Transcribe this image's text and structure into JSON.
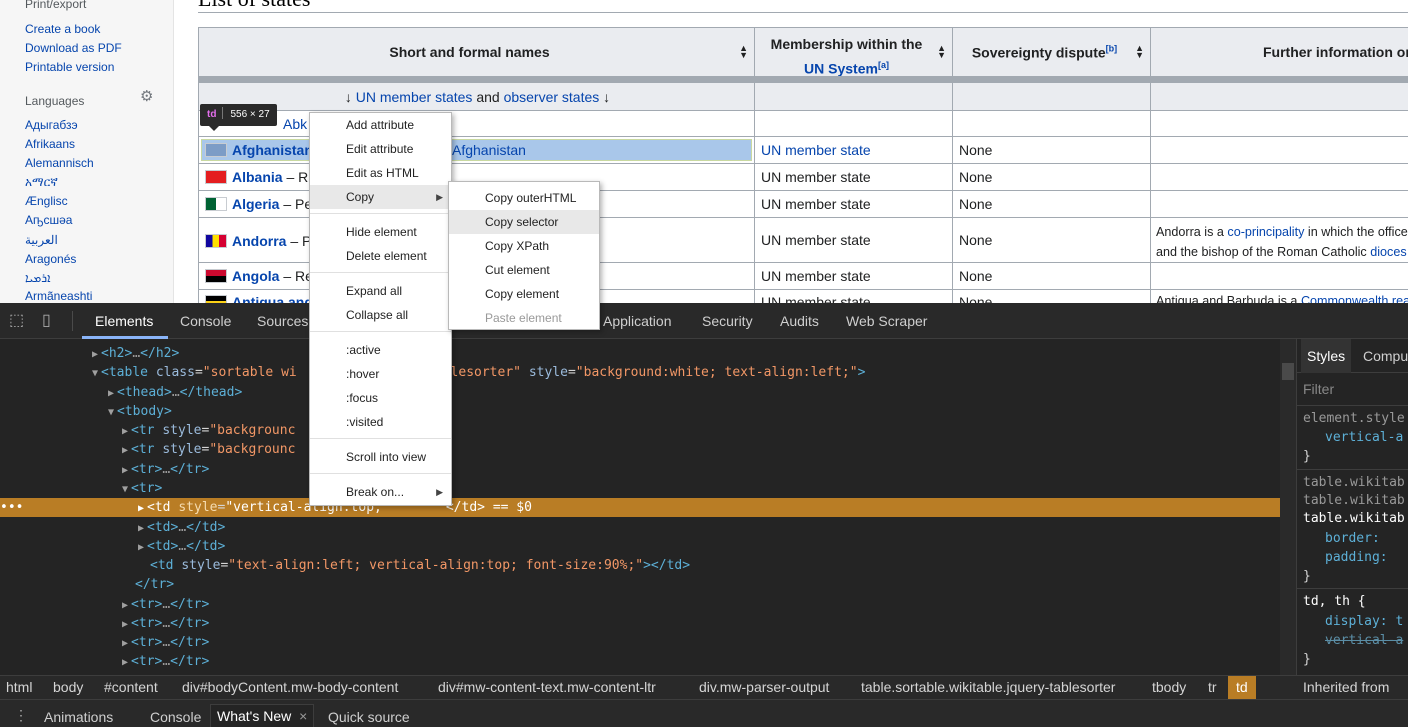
{
  "sidebar": {
    "print_export": "Print/export",
    "tools": [
      "Create a book",
      "Download as PDF",
      "Printable version"
    ],
    "languages_heading": "Languages",
    "languages": [
      "Адыгабзэ",
      "Afrikaans",
      "Alemannisch",
      "አማርኛ",
      "Ænglisc",
      "Аҧсшәа",
      "العربية",
      "Aragonés",
      "ܐܪܡܝܐ",
      "Armãneashti"
    ]
  },
  "page": {
    "heading": "List of states"
  },
  "table": {
    "headers": {
      "names": "Short and formal names",
      "membership": "Membership within the",
      "membership_link": "UN System",
      "membership_sup": "[a]",
      "dispute": "Sovereignty dispute",
      "dispute_sup": "[b]",
      "further": "Further information on"
    },
    "group_row": {
      "arrow": "↓",
      "link1": "UN member states",
      "and": "and",
      "link2": "observer states",
      "arrow2": "↓"
    },
    "rows": [
      {
        "name": "",
        "suffix": "Abk",
        "membership": "",
        "dispute": "",
        "info": ""
      },
      {
        "name": "Afghanistan",
        "suffix": "Afghanistan",
        "membership": "UN member state",
        "dispute": "None",
        "info": ""
      },
      {
        "name": "Albania",
        "suffix": "– R",
        "membership": "UN member state",
        "dispute": "None",
        "info": ""
      },
      {
        "name": "Algeria",
        "suffix": "– Pe",
        "membership": "UN member state",
        "dispute": "None",
        "info": ""
      },
      {
        "name": "Andorra",
        "suffix": "– P",
        "membership": "UN member state",
        "dispute": "None",
        "info_1": "Andorra is a",
        "info_link": "co-principality",
        "info_2": "in which the office",
        "info_3": "and the bishop of the Roman Catholic",
        "info_link2": "dioces"
      },
      {
        "name": "Angola",
        "suffix": "– Re",
        "membership": "UN member state",
        "dispute": "None",
        "info": ""
      },
      {
        "name": "Antigua and",
        "suffix": "",
        "membership": "UN member state",
        "dispute": "None",
        "info_1": "Antigua and Barbuda is a",
        "info_link": "Commonwealth rea"
      }
    ]
  },
  "tooltip": {
    "tag": "td",
    "size": "556 × 27"
  },
  "context_menu": {
    "items": [
      "Add attribute",
      "Edit attribute",
      "Edit as HTML",
      "Copy",
      "Hide element",
      "Delete element",
      "Expand all",
      "Collapse all",
      ":active",
      ":hover",
      ":focus",
      ":visited",
      "Scroll into view",
      "Break on..."
    ],
    "submenu_arrow": "▶"
  },
  "copy_submenu": {
    "items": [
      "Copy outerHTML",
      "Copy selector",
      "Copy XPath",
      "Cut element",
      "Copy element",
      "Paste element"
    ]
  },
  "devtools": {
    "tabs": [
      "Elements",
      "Console",
      "Sources",
      "Application",
      "Security",
      "Audits",
      "Web Scraper"
    ],
    "elements": {
      "l_h2_open": "<h2>",
      "l_h2_close": "</h2>",
      "ellipsis": "…",
      "table_open": "<table",
      "class_attr": "class",
      "class_val_a": "\"sortable wi",
      "class_val_b": "blesorter\"",
      "style_attr": "style",
      "table_style": "\"background:white; text-align:left;\"",
      "close_bracket": ">",
      "thead": "<thead>",
      "thead_close": "</thead>",
      "tbody": "<tbody>",
      "tr_style": "<tr",
      "bg_val": "\"backgrounc",
      "tr_open": "<tr>",
      "tr_close": "</tr>",
      "td_open": "<td",
      "td_open_plain": "<td>",
      "td_close": "</td>",
      "td_style_sel": "\"vertical-align:top;",
      "sel_suffix": "== $0",
      "td4_style": "\"text-align:left; vertical-align:top; font-size:90%;\"",
      "td_end": "></td>"
    },
    "styles": {
      "tabs": [
        "Styles",
        "Compu"
      ],
      "filter": "Filter",
      "lines": [
        "element.style",
        "vertical-a",
        "}",
        "table.wikitab",
        "table.wikitab",
        "table.wikitab",
        "border:",
        "padding:",
        "}",
        "td, th {",
        "display: t",
        "vertical-a",
        "}"
      ],
      "inherited": "Inherited from"
    },
    "breadcrumbs": [
      "html",
      "body",
      "#content",
      "div#bodyContent.mw-body-content",
      "div#mw-content-text.mw-content-ltr",
      "div.mw-parser-output",
      "table.sortable.wikitable.jquery-tablesorter",
      "tbody",
      "tr",
      "td"
    ],
    "drawer_tabs": [
      "Animations",
      "Console",
      "What's New",
      "Quick source"
    ],
    "drawer_close": "×"
  },
  "colors": {
    "link": "#0645ad",
    "selected_row": "#b97d25",
    "highlight_cell": "#a9c7ea"
  }
}
